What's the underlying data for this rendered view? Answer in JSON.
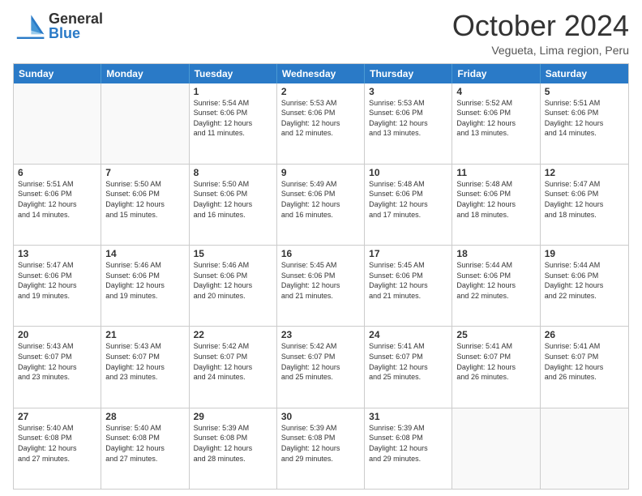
{
  "logo": {
    "general": "General",
    "blue": "Blue"
  },
  "title": "October 2024",
  "location": "Vegueta, Lima region, Peru",
  "days": [
    "Sunday",
    "Monday",
    "Tuesday",
    "Wednesday",
    "Thursday",
    "Friday",
    "Saturday"
  ],
  "weeks": [
    [
      {
        "day": "",
        "info": ""
      },
      {
        "day": "",
        "info": ""
      },
      {
        "day": "1",
        "info": "Sunrise: 5:54 AM\nSunset: 6:06 PM\nDaylight: 12 hours\nand 11 minutes."
      },
      {
        "day": "2",
        "info": "Sunrise: 5:53 AM\nSunset: 6:06 PM\nDaylight: 12 hours\nand 12 minutes."
      },
      {
        "day": "3",
        "info": "Sunrise: 5:53 AM\nSunset: 6:06 PM\nDaylight: 12 hours\nand 13 minutes."
      },
      {
        "day": "4",
        "info": "Sunrise: 5:52 AM\nSunset: 6:06 PM\nDaylight: 12 hours\nand 13 minutes."
      },
      {
        "day": "5",
        "info": "Sunrise: 5:51 AM\nSunset: 6:06 PM\nDaylight: 12 hours\nand 14 minutes."
      }
    ],
    [
      {
        "day": "6",
        "info": "Sunrise: 5:51 AM\nSunset: 6:06 PM\nDaylight: 12 hours\nand 14 minutes."
      },
      {
        "day": "7",
        "info": "Sunrise: 5:50 AM\nSunset: 6:06 PM\nDaylight: 12 hours\nand 15 minutes."
      },
      {
        "day": "8",
        "info": "Sunrise: 5:50 AM\nSunset: 6:06 PM\nDaylight: 12 hours\nand 16 minutes."
      },
      {
        "day": "9",
        "info": "Sunrise: 5:49 AM\nSunset: 6:06 PM\nDaylight: 12 hours\nand 16 minutes."
      },
      {
        "day": "10",
        "info": "Sunrise: 5:48 AM\nSunset: 6:06 PM\nDaylight: 12 hours\nand 17 minutes."
      },
      {
        "day": "11",
        "info": "Sunrise: 5:48 AM\nSunset: 6:06 PM\nDaylight: 12 hours\nand 18 minutes."
      },
      {
        "day": "12",
        "info": "Sunrise: 5:47 AM\nSunset: 6:06 PM\nDaylight: 12 hours\nand 18 minutes."
      }
    ],
    [
      {
        "day": "13",
        "info": "Sunrise: 5:47 AM\nSunset: 6:06 PM\nDaylight: 12 hours\nand 19 minutes."
      },
      {
        "day": "14",
        "info": "Sunrise: 5:46 AM\nSunset: 6:06 PM\nDaylight: 12 hours\nand 19 minutes."
      },
      {
        "day": "15",
        "info": "Sunrise: 5:46 AM\nSunset: 6:06 PM\nDaylight: 12 hours\nand 20 minutes."
      },
      {
        "day": "16",
        "info": "Sunrise: 5:45 AM\nSunset: 6:06 PM\nDaylight: 12 hours\nand 21 minutes."
      },
      {
        "day": "17",
        "info": "Sunrise: 5:45 AM\nSunset: 6:06 PM\nDaylight: 12 hours\nand 21 minutes."
      },
      {
        "day": "18",
        "info": "Sunrise: 5:44 AM\nSunset: 6:06 PM\nDaylight: 12 hours\nand 22 minutes."
      },
      {
        "day": "19",
        "info": "Sunrise: 5:44 AM\nSunset: 6:06 PM\nDaylight: 12 hours\nand 22 minutes."
      }
    ],
    [
      {
        "day": "20",
        "info": "Sunrise: 5:43 AM\nSunset: 6:07 PM\nDaylight: 12 hours\nand 23 minutes."
      },
      {
        "day": "21",
        "info": "Sunrise: 5:43 AM\nSunset: 6:07 PM\nDaylight: 12 hours\nand 23 minutes."
      },
      {
        "day": "22",
        "info": "Sunrise: 5:42 AM\nSunset: 6:07 PM\nDaylight: 12 hours\nand 24 minutes."
      },
      {
        "day": "23",
        "info": "Sunrise: 5:42 AM\nSunset: 6:07 PM\nDaylight: 12 hours\nand 25 minutes."
      },
      {
        "day": "24",
        "info": "Sunrise: 5:41 AM\nSunset: 6:07 PM\nDaylight: 12 hours\nand 25 minutes."
      },
      {
        "day": "25",
        "info": "Sunrise: 5:41 AM\nSunset: 6:07 PM\nDaylight: 12 hours\nand 26 minutes."
      },
      {
        "day": "26",
        "info": "Sunrise: 5:41 AM\nSunset: 6:07 PM\nDaylight: 12 hours\nand 26 minutes."
      }
    ],
    [
      {
        "day": "27",
        "info": "Sunrise: 5:40 AM\nSunset: 6:08 PM\nDaylight: 12 hours\nand 27 minutes."
      },
      {
        "day": "28",
        "info": "Sunrise: 5:40 AM\nSunset: 6:08 PM\nDaylight: 12 hours\nand 27 minutes."
      },
      {
        "day": "29",
        "info": "Sunrise: 5:39 AM\nSunset: 6:08 PM\nDaylight: 12 hours\nand 28 minutes."
      },
      {
        "day": "30",
        "info": "Sunrise: 5:39 AM\nSunset: 6:08 PM\nDaylight: 12 hours\nand 29 minutes."
      },
      {
        "day": "31",
        "info": "Sunrise: 5:39 AM\nSunset: 6:08 PM\nDaylight: 12 hours\nand 29 minutes."
      },
      {
        "day": "",
        "info": ""
      },
      {
        "day": "",
        "info": ""
      }
    ]
  ]
}
